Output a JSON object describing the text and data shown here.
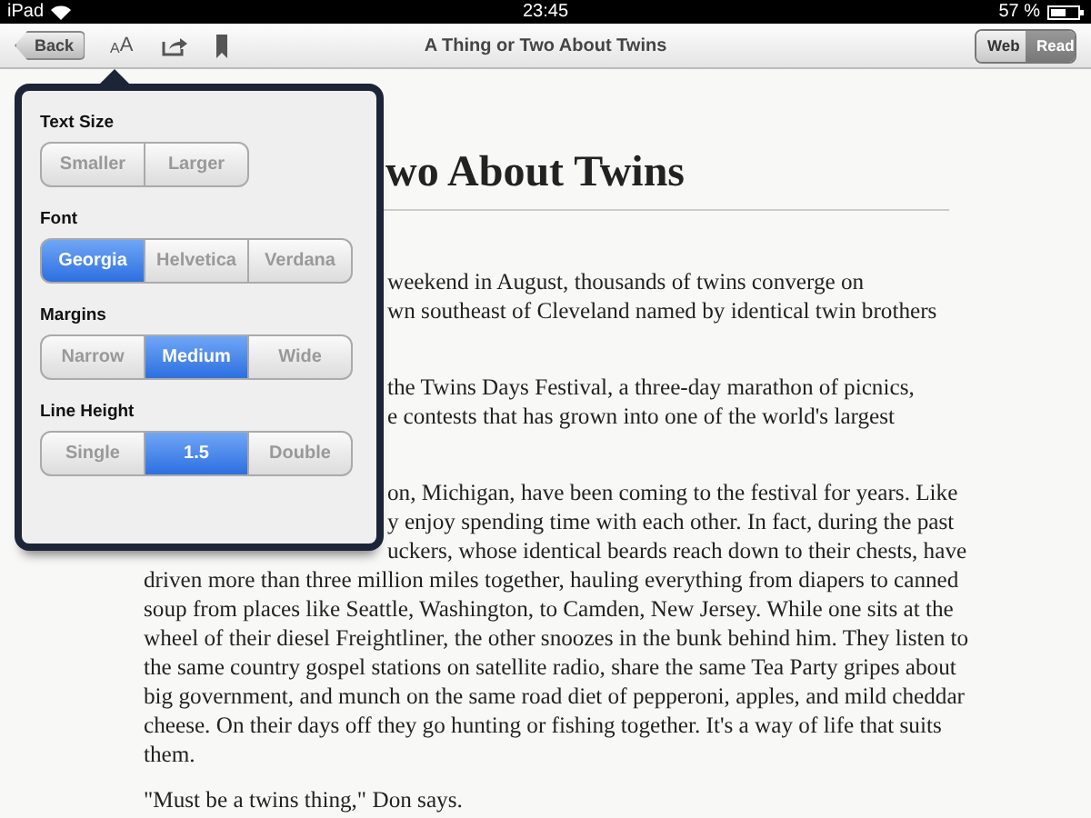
{
  "status_bar": {
    "device": "iPad",
    "time": "23:45",
    "battery": "57 %"
  },
  "toolbar": {
    "back": "Back",
    "font_button": [
      "A",
      "A"
    ],
    "title": "A Thing or Two About Twins",
    "view_modes": [
      {
        "label": "Web",
        "selected": false
      },
      {
        "label": "Read",
        "selected": true
      }
    ]
  },
  "article": {
    "heading": {
      "text": "wo About Twins",
      "kind": "clipped"
    },
    "paragraphs": [
      {
        "lines": [
          {
            "text": "weekend in August, thousands of twins converge on",
            "kind": "clipped"
          },
          {
            "text": "wn southeast of Cleveland named by identical twin brothers",
            "kind": "clipped"
          }
        ]
      },
      {
        "lines": [
          {
            "text": "the Twins Days Festival, a three-day marathon of picnics,",
            "kind": "clipped"
          },
          {
            "text": "e contests that has grown into one of the world's largest",
            "kind": "clipped"
          }
        ]
      },
      {
        "lines": [
          {
            "text": "on, Michigan, have been coming to the festival for years. Like",
            "kind": "clipped"
          },
          {
            "text": "y enjoy spending time with each other. In fact, during the past",
            "kind": "clipped"
          },
          {
            "text": "uckers, whose identical beards reach down to their chests, have",
            "kind": "clipped"
          },
          {
            "text": "driven more than three million miles together, hauling everything from diapers to canned",
            "kind": "full"
          },
          {
            "text": "soup from places like Seattle, Washington, to Camden, New Jersey. While one sits at the",
            "kind": "full"
          },
          {
            "text": "wheel of their diesel Freightliner, the other snoozes in the bunk behind him. They listen to",
            "kind": "full"
          },
          {
            "text": "the same country gospel stations on satellite radio, share the same Tea Party gripes about",
            "kind": "full"
          },
          {
            "text": "big government, and munch on the same road diet of pepperoni, apples, and mild cheddar",
            "kind": "full"
          },
          {
            "text": "cheese. On their days off they go hunting or fishing together. It's a way of life that suits",
            "kind": "full"
          },
          {
            "text": "them.",
            "kind": "full"
          }
        ]
      },
      {
        "lines": [
          {
            "text": "\"Must be a twins thing,\" Don says.",
            "kind": "full"
          }
        ]
      }
    ]
  },
  "popover": {
    "sections": [
      {
        "label": "Text Size",
        "options": [
          {
            "label": "Smaller",
            "selected": false
          },
          {
            "label": "Larger",
            "selected": false
          }
        ]
      },
      {
        "label": "Font",
        "options": [
          {
            "label": "Georgia",
            "selected": true
          },
          {
            "label": "Helvetica",
            "selected": false
          },
          {
            "label": "Verdana",
            "selected": false
          }
        ]
      },
      {
        "label": "Margins",
        "options": [
          {
            "label": "Narrow",
            "selected": false
          },
          {
            "label": "Medium",
            "selected": true
          },
          {
            "label": "Wide",
            "selected": false
          }
        ]
      },
      {
        "label": "Line Height",
        "options": [
          {
            "label": "Single",
            "selected": false
          },
          {
            "label": "1.5",
            "selected": true
          },
          {
            "label": "Double",
            "selected": false
          }
        ]
      }
    ]
  }
}
